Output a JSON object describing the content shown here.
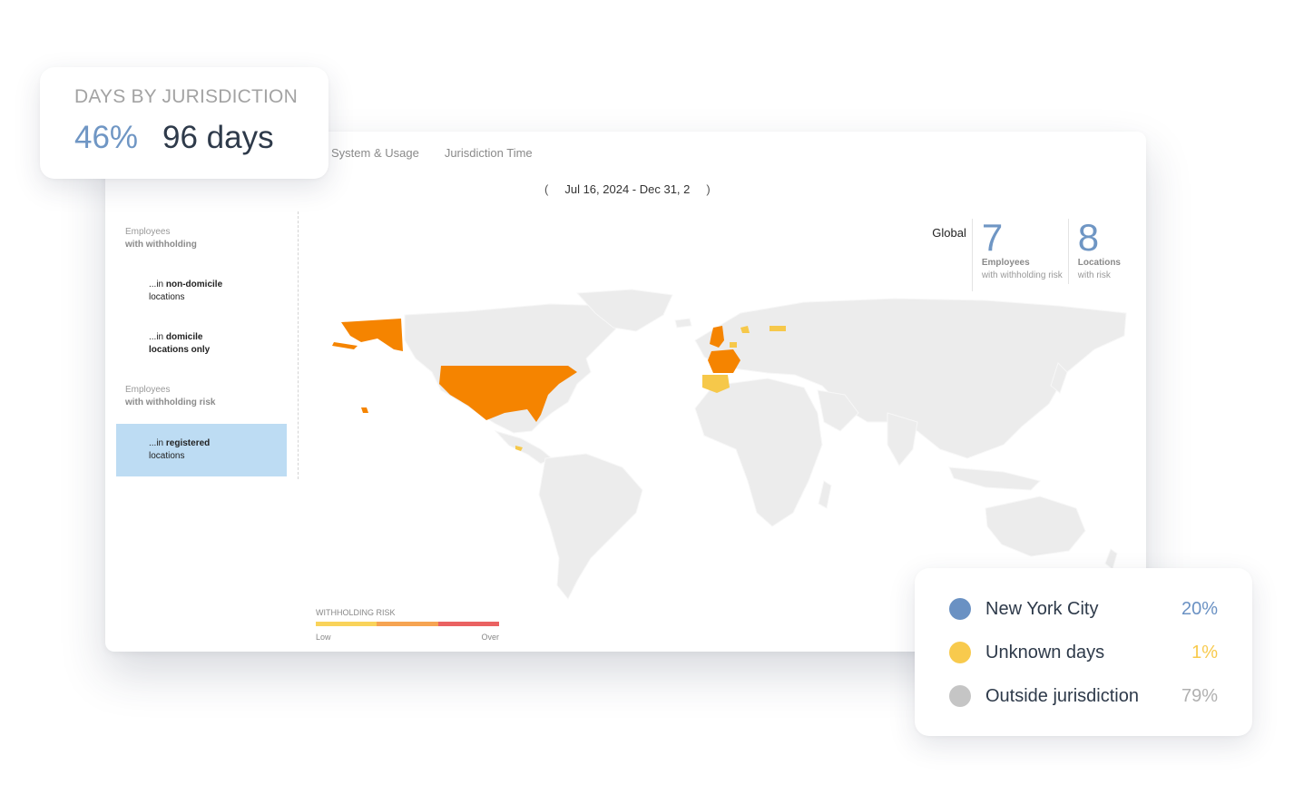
{
  "tabs": [
    "System & Usage",
    "Jurisdiction Time"
  ],
  "date_range": {
    "prev": "(",
    "label": "Jul 16, 2024 - Dec 31, 2",
    "next": ")"
  },
  "sidebar": {
    "label_withholding": {
      "line1": "Employees",
      "line2": "with withholding"
    },
    "item_non_domicile": {
      "prefix": "...in ",
      "bold": "non-domicile",
      "rest": "locations"
    },
    "item_domicile": {
      "prefix": "...in ",
      "bold": "domicile",
      "rest": "locations only"
    },
    "label_risk": {
      "line1": "Employees",
      "line2": "with withholding risk"
    },
    "item_registered": {
      "prefix": "...in ",
      "bold": "registered",
      "rest": "locations"
    }
  },
  "stats": {
    "global_label": "Global",
    "employees": {
      "value": "7",
      "label1": "Employees",
      "label2": "with withholding risk"
    },
    "locations": {
      "value": "8",
      "label1": "Locations",
      "label2": "with risk"
    }
  },
  "withholding_legend": {
    "title": "WITHHOLDING RISK",
    "low": "Low",
    "over": "Over",
    "colors": [
      "#f9d35a",
      "#f6a452",
      "#ea6262"
    ]
  },
  "days_card": {
    "title": "DAYS BY JURISDICTION",
    "percent": "46%",
    "days": "96 days"
  },
  "jurisdiction_legend": [
    {
      "name": "New York City",
      "value": "20%",
      "color": "#6a91c3"
    },
    {
      "name": "Unknown days",
      "value": "1%",
      "color": "#f8ca4d"
    },
    {
      "name": "Outside jurisdiction",
      "value": "79%",
      "color": "#c5c5c5"
    }
  ],
  "colors": {
    "land": "#ececec",
    "high_risk": "#f58400",
    "low_risk": "#f6c84a",
    "accent": "#6f96c4"
  }
}
